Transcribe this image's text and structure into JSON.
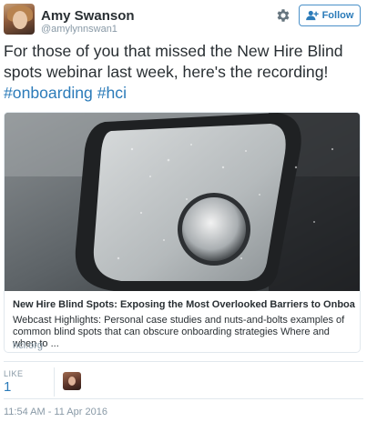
{
  "user": {
    "name": "Amy Swanson",
    "handle": "@amylynnswan1"
  },
  "header": {
    "follow_label": "Follow"
  },
  "tweet": {
    "text_plain": "For those of you that missed the New Hire Blind spots webinar last week, here's the recording! ",
    "hashtags": [
      "#onboarding",
      "#hci"
    ]
  },
  "card": {
    "title": "New Hire Blind Spots: Exposing the Most Overlooked Barriers to Onboardin...",
    "description": "Webcast Highlights: Personal case studies and nuts-and-bolts examples of common blind spots that can obscure onboarding strategies Where and when to ...",
    "domain": "hci.org"
  },
  "stats": {
    "like_label": "LIKE",
    "like_count": "1"
  },
  "timestamp": "11:54 AM - 11 Apr 2016",
  "colors": {
    "link": "#2b7bb9",
    "text": "#292f33",
    "muted": "#8899a6",
    "border": "#e1e8ed"
  },
  "icons": [
    "gear-icon",
    "follow-person-icon",
    "side-mirror-photo"
  ]
}
